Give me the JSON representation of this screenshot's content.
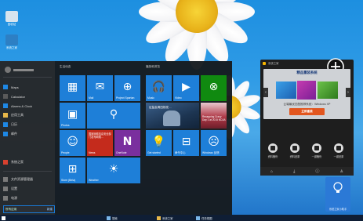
{
  "desktop": {
    "icons": [
      {
        "label": "回收站",
        "color": "#d8e4ee"
      },
      {
        "label": "系统之家",
        "color": "#2d7fc4"
      }
    ]
  },
  "startmenu": {
    "user_icon": "user-avatar-icon",
    "apps": [
      {
        "label": "Maps",
        "icon": "map-icon",
        "color": "#1e88e5"
      },
      {
        "label": "Calculator",
        "icon": "calculator-icon",
        "color": "#5a5a5a"
      },
      {
        "label": "Alarms & Clock",
        "icon": "alarm-icon",
        "color": "#1e88e5"
      },
      {
        "label": "应用工具",
        "icon": "tools-icon",
        "color": "#e8b84a"
      },
      {
        "label": "日历",
        "icon": "calendar-icon",
        "color": "#1e88e5"
      },
      {
        "label": "邮件",
        "icon": "mail-icon",
        "color": "#1e88e5"
      },
      {
        "label": "系统之家",
        "icon": "app-icon",
        "color": "#d8412f"
      },
      {
        "label": "文件资源管理器",
        "icon": "folder-icon",
        "color": "#7a7a7a"
      },
      {
        "label": "设置",
        "icon": "settings-icon",
        "color": "#7a7a7a"
      },
      {
        "label": "电源",
        "icon": "power-icon",
        "color": "#7a7a7a"
      }
    ],
    "search": {
      "label": "所有应用",
      "hint": "新建"
    },
    "group_left_title": "生活动态",
    "group_right_title": "播放和浏览",
    "tiles": [
      {
        "label": "",
        "icon": "calendar-icon",
        "color": "#1e7fd8",
        "glyph": "▦"
      },
      {
        "label": "Mail",
        "icon": "mail-icon",
        "color": "#1e7fd8",
        "glyph": "✉"
      },
      {
        "label": "Project Spartan",
        "icon": "globe-icon",
        "color": "#1e7fd8",
        "glyph": "⊕"
      },
      {
        "label": "Photos",
        "icon": "photos-icon",
        "color": "#1e7fd8",
        "glyph": "▣"
      },
      {
        "label": "",
        "icon": "search-icon",
        "color": "#1e7fd8",
        "glyph": "⚲"
      },
      {
        "label": "People",
        "icon": "people-icon",
        "color": "#1e7fd8",
        "glyph": "☺"
      },
      {
        "label": "News",
        "icon": "news-icon",
        "color": "#c42b1c",
        "glyph": "",
        "caption": "国家网络信息安全部门发布网络…"
      },
      {
        "label": "OneNote",
        "icon": "onenote-icon",
        "color": "#7a2f9e",
        "glyph": "N"
      },
      {
        "label": "Store (Beta)",
        "icon": "store-icon",
        "color": "#1e7fd8",
        "glyph": "⊞"
      },
      {
        "label": "Weather",
        "icon": "weather-icon",
        "color": "#1e7fd8",
        "glyph": "☀"
      },
      {
        "label": "Music",
        "icon": "music-icon",
        "color": "#1e7fd8",
        "glyph": "🎧"
      },
      {
        "label": "Video",
        "icon": "video-icon",
        "color": "#1e7fd8",
        "glyph": "▶"
      },
      {
        "label": "",
        "icon": "xbox-icon",
        "color": "#108a10",
        "glyph": "⊗"
      },
      {
        "label": "",
        "icon": "news-photo-tile",
        "color": "#24456a",
        "glyph": "",
        "caption": "证监会周四核发…"
      },
      {
        "label": "",
        "icon": "sport-photo-tile",
        "color": "#b03a48",
        "glyph": "",
        "caption": "Recapping Crazy Day 1 at 2015 NCAA"
      },
      {
        "label": "Get started",
        "icon": "bulb-icon",
        "color": "#1e7fd8",
        "glyph": "💡"
      },
      {
        "label": "命令中心",
        "icon": "command-icon",
        "color": "#1e7fd8",
        "glyph": "⊟"
      },
      {
        "label": "Windows 反馈",
        "icon": "feedback-icon",
        "color": "#1e7fd8",
        "glyph": "☹"
      }
    ]
  },
  "taskbar": {
    "items": [
      "搜索",
      "系统之家",
      "任务视图"
    ]
  },
  "popup": {
    "header": "系统之家",
    "banner_title": "精品重装系统",
    "banner_subtitle": "云端最优匹配推荐系统：Windows XP",
    "banner_button": "立即重装",
    "actions": [
      "资料备份",
      "资料还原",
      "一键备份",
      "一键还原"
    ],
    "bottom_icons": [
      "home-icon",
      "download-icon",
      "info-icon",
      "user-icon"
    ]
  },
  "assistant": {
    "label": "系统之家小助手"
  }
}
